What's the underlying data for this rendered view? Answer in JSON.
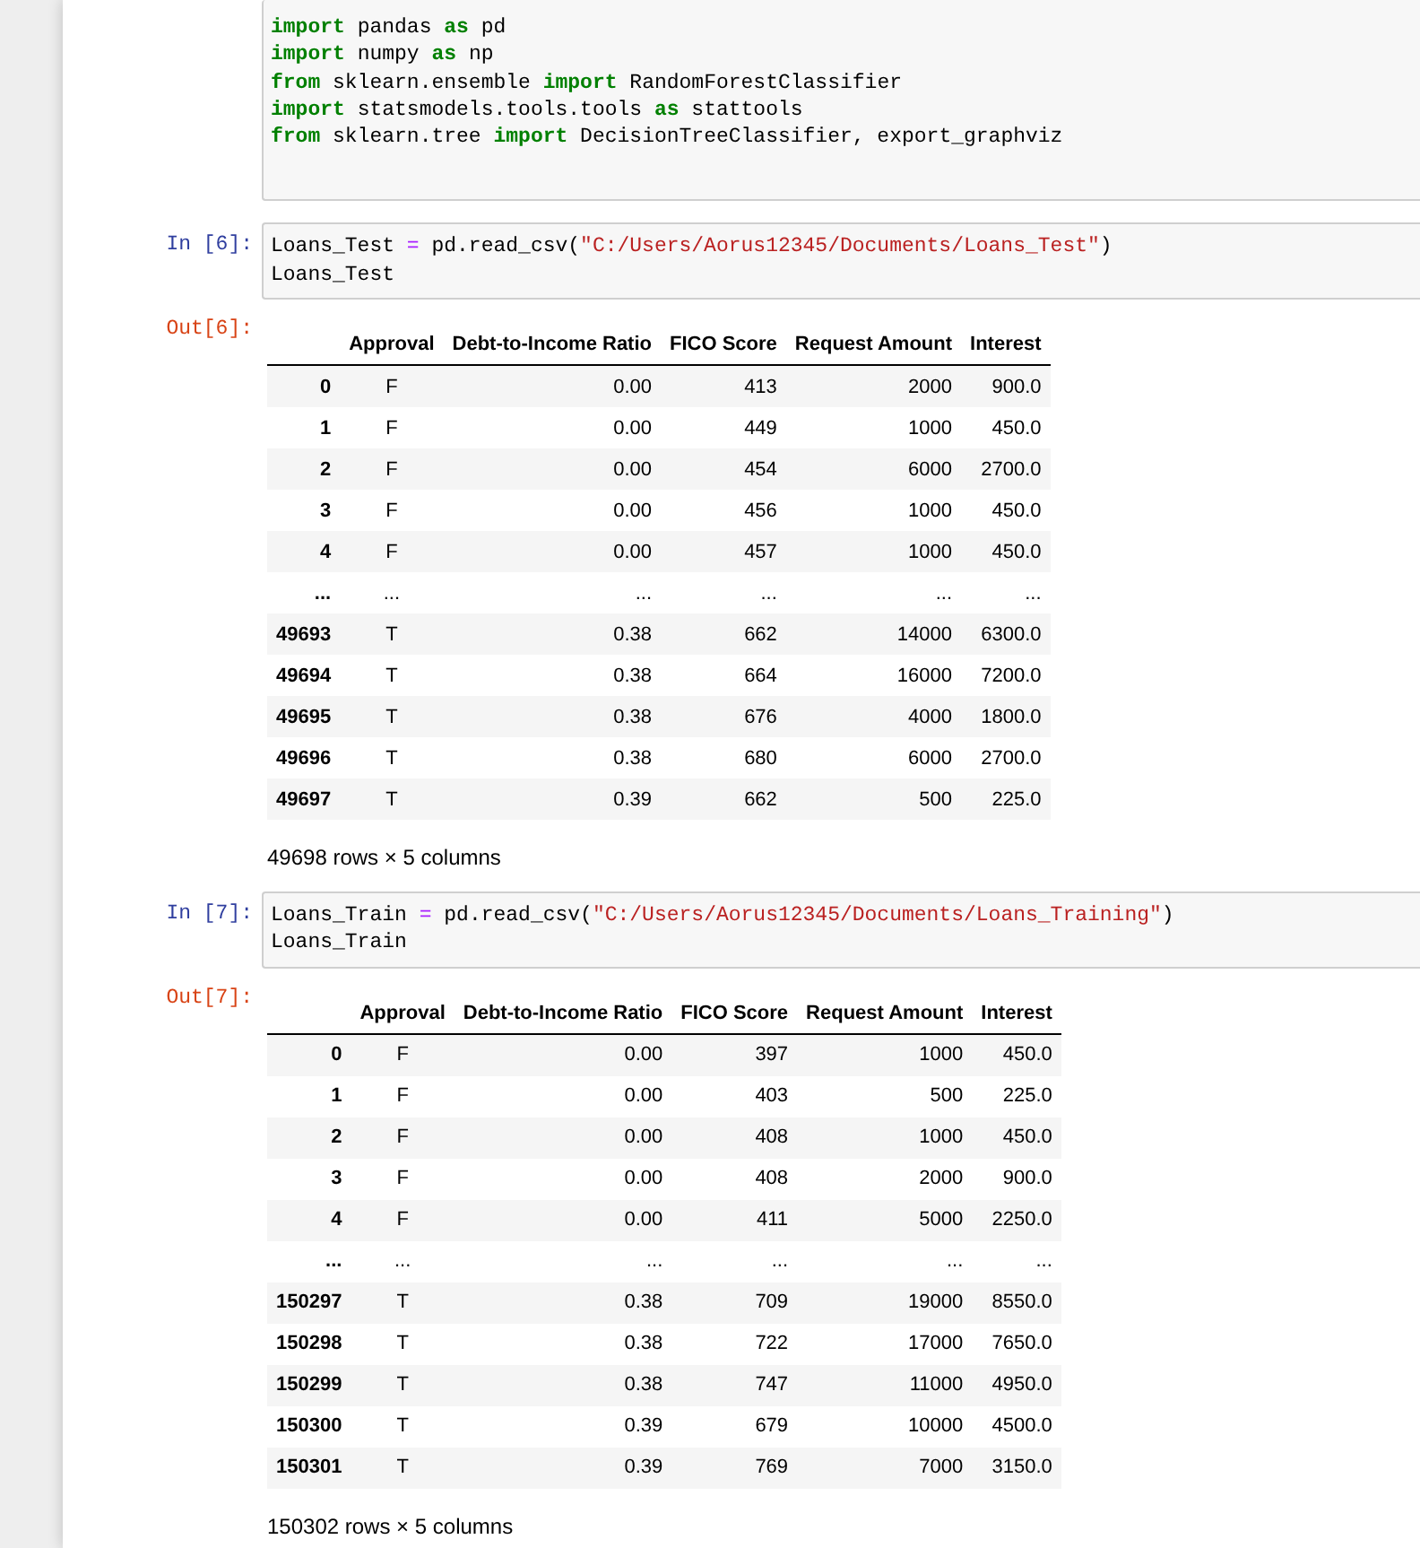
{
  "cells": [
    {
      "kind": "code",
      "lines": [
        [
          {
            "t": "import",
            "kind": "kw"
          },
          {
            "t": " pandas ",
            "kind": "plain"
          },
          {
            "t": "as",
            "kind": "kw"
          },
          {
            "t": " pd",
            "kind": "plain"
          }
        ],
        [
          {
            "t": "import",
            "kind": "kw"
          },
          {
            "t": " numpy ",
            "kind": "plain"
          },
          {
            "t": "as",
            "kind": "kw"
          },
          {
            "t": " np",
            "kind": "plain"
          }
        ],
        [
          {
            "t": "from",
            "kind": "kw"
          },
          {
            "t": " sklearn.ensemble ",
            "kind": "plain"
          },
          {
            "t": "import",
            "kind": "kw"
          },
          {
            "t": " RandomForestClassifier",
            "kind": "plain"
          }
        ],
        [
          {
            "t": "import",
            "kind": "kw"
          },
          {
            "t": " statsmodels.tools.tools ",
            "kind": "plain"
          },
          {
            "t": "as",
            "kind": "kw"
          },
          {
            "t": " stattools",
            "kind": "plain"
          }
        ],
        [
          {
            "t": "from",
            "kind": "kw"
          },
          {
            "t": " sklearn.tree ",
            "kind": "plain"
          },
          {
            "t": "import",
            "kind": "kw"
          },
          {
            "t": " DecisionTreeClassifier, export_graphviz",
            "kind": "plain"
          }
        ]
      ]
    },
    {
      "kind": "code",
      "prompt": "In [6]:",
      "lines": [
        [
          {
            "t": "Loans_Test ",
            "kind": "plain"
          },
          {
            "t": "=",
            "kind": "op"
          },
          {
            "t": " pd.read_csv(",
            "kind": "plain"
          },
          {
            "t": "\"C:/Users/Aorus12345/Documents/Loans_Test\"",
            "kind": "str"
          },
          {
            "t": ")",
            "kind": "plain"
          }
        ],
        [
          {
            "t": "Loans_Test",
            "kind": "plain"
          }
        ]
      ]
    },
    {
      "kind": "output",
      "prompt": "Out[6]:",
      "columns": [
        "Approval",
        "Debt-to-Income Ratio",
        "FICO Score",
        "Request Amount",
        "Interest"
      ],
      "rows": [
        {
          "index": "0",
          "cells": [
            "F",
            "0.00",
            "413",
            "2000",
            "900.0"
          ]
        },
        {
          "index": "1",
          "cells": [
            "F",
            "0.00",
            "449",
            "1000",
            "450.0"
          ]
        },
        {
          "index": "2",
          "cells": [
            "F",
            "0.00",
            "454",
            "6000",
            "2700.0"
          ]
        },
        {
          "index": "3",
          "cells": [
            "F",
            "0.00",
            "456",
            "1000",
            "450.0"
          ]
        },
        {
          "index": "4",
          "cells": [
            "F",
            "0.00",
            "457",
            "1000",
            "450.0"
          ]
        },
        {
          "index": "...",
          "cells": [
            "...",
            "...",
            "...",
            "...",
            "..."
          ]
        },
        {
          "index": "49693",
          "cells": [
            "T",
            "0.38",
            "662",
            "14000",
            "6300.0"
          ]
        },
        {
          "index": "49694",
          "cells": [
            "T",
            "0.38",
            "664",
            "16000",
            "7200.0"
          ]
        },
        {
          "index": "49695",
          "cells": [
            "T",
            "0.38",
            "676",
            "4000",
            "1800.0"
          ]
        },
        {
          "index": "49696",
          "cells": [
            "T",
            "0.38",
            "680",
            "6000",
            "2700.0"
          ]
        },
        {
          "index": "49697",
          "cells": [
            "T",
            "0.39",
            "662",
            "500",
            "225.0"
          ]
        }
      ],
      "summary": "49698 rows × 5 columns"
    },
    {
      "kind": "code",
      "prompt": "In [7]:",
      "lines": [
        [
          {
            "t": "Loans_Train ",
            "kind": "plain"
          },
          {
            "t": "=",
            "kind": "op"
          },
          {
            "t": " pd.read_csv(",
            "kind": "plain"
          },
          {
            "t": "\"C:/Users/Aorus12345/Documents/Loans_Training\"",
            "kind": "str"
          },
          {
            "t": ")",
            "kind": "plain"
          }
        ],
        [
          {
            "t": "Loans_Train",
            "kind": "plain"
          }
        ]
      ]
    },
    {
      "kind": "output",
      "prompt": "Out[7]:",
      "columns": [
        "Approval",
        "Debt-to-Income Ratio",
        "FICO Score",
        "Request Amount",
        "Interest"
      ],
      "rows": [
        {
          "index": "0",
          "cells": [
            "F",
            "0.00",
            "397",
            "1000",
            "450.0"
          ]
        },
        {
          "index": "1",
          "cells": [
            "F",
            "0.00",
            "403",
            "500",
            "225.0"
          ]
        },
        {
          "index": "2",
          "cells": [
            "F",
            "0.00",
            "408",
            "1000",
            "450.0"
          ]
        },
        {
          "index": "3",
          "cells": [
            "F",
            "0.00",
            "408",
            "2000",
            "900.0"
          ]
        },
        {
          "index": "4",
          "cells": [
            "F",
            "0.00",
            "411",
            "5000",
            "2250.0"
          ]
        },
        {
          "index": "...",
          "cells": [
            "...",
            "...",
            "...",
            "...",
            "..."
          ]
        },
        {
          "index": "150297",
          "cells": [
            "T",
            "0.38",
            "709",
            "19000",
            "8550.0"
          ]
        },
        {
          "index": "150298",
          "cells": [
            "T",
            "0.38",
            "722",
            "17000",
            "7650.0"
          ]
        },
        {
          "index": "150299",
          "cells": [
            "T",
            "0.38",
            "747",
            "11000",
            "4950.0"
          ]
        },
        {
          "index": "150300",
          "cells": [
            "T",
            "0.39",
            "679",
            "10000",
            "4500.0"
          ]
        },
        {
          "index": "150301",
          "cells": [
            "T",
            "0.39",
            "769",
            "7000",
            "3150.0"
          ]
        }
      ],
      "summary": "150302 rows × 5 columns"
    }
  ]
}
